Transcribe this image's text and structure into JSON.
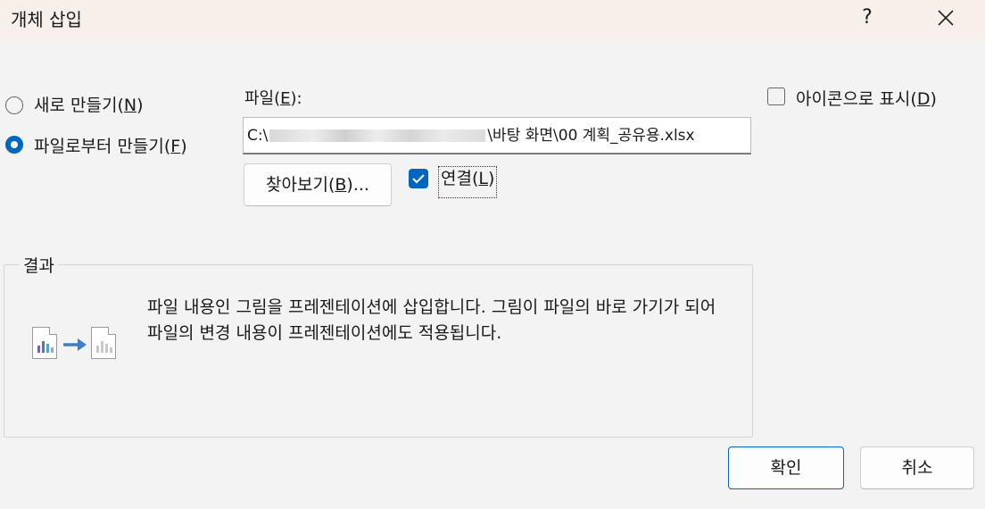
{
  "window": {
    "title": "개체 삽입",
    "help_label": "?",
    "close_icon": "close-icon"
  },
  "options": {
    "create_new": {
      "text": "새로 만들기(",
      "key": "N",
      "end": ")",
      "selected": false
    },
    "create_from_file": {
      "text": "파일로부터 만들기(",
      "key": "F",
      "end": ")",
      "selected": true
    }
  },
  "file": {
    "label_text": "파일(",
    "label_key": "E",
    "label_end": "):",
    "path_start": "C:\\",
    "path_end": "\\바탕 화면\\00 계획_공유용.xlsx",
    "browse_text": "찾아보기(",
    "browse_key": "B",
    "browse_end": ")...",
    "link_text": "연결(",
    "link_key": "L",
    "link_end": ")",
    "link_checked": true
  },
  "display_as_icon": {
    "text": "아이콘으로 표시(",
    "key": "D",
    "end": ")",
    "checked": false
  },
  "result": {
    "group_label": "결과",
    "description": "파일 내용인 그림을 프레젠테이션에 삽입합니다. 그림이 파일의 바로 가기가 되어 파일의 변경 내용이 프레젠테이션에도 적용됩니다.",
    "icon": "linked-chart-icon"
  },
  "buttons": {
    "ok": "확인",
    "cancel": "취소"
  },
  "colors": {
    "accent": "#0067c0",
    "title_bar": "#f7efe9",
    "background": "#f3f3f3"
  }
}
